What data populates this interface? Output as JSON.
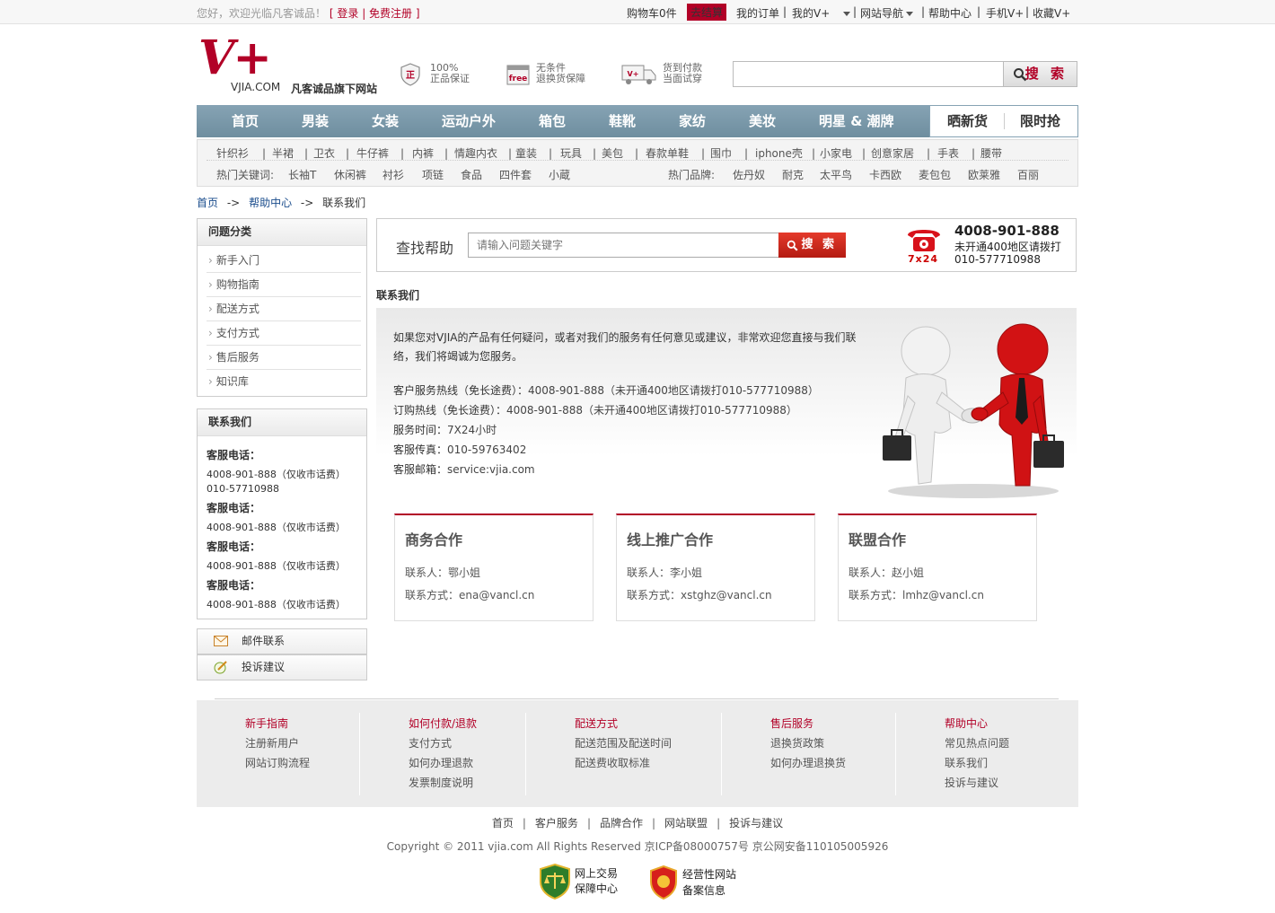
{
  "topbar": {
    "greeting": "您好，欢迎光临凡客诚品！",
    "login": "登录",
    "register": "免费注册",
    "cart": "购物车0件",
    "checkout": "去结算",
    "orders": "我的订单",
    "my_vplus": "我的V+",
    "site_nav": "网站导航",
    "help": "帮助中心",
    "mobile": "手机V+",
    "favorite": "收藏V+"
  },
  "header": {
    "logo_mark": "V+",
    "logo_domain": "VJIA.COM",
    "logo_tagline": "凡客诚品旗下网站",
    "promo1_line1": "100%",
    "promo1_line2": "正品保证",
    "promo1_icon": "正",
    "promo2_line1": "无条件",
    "promo2_line2": "退换货保障",
    "promo2_icon": "free",
    "promo3_line1": "货到付款",
    "promo3_line2": "当面试穿",
    "search_label": "搜 索"
  },
  "nav": {
    "items": [
      "首页",
      "男装",
      "女装",
      "运动户外",
      "箱包",
      "鞋靴",
      "家纺",
      "美妆",
      "明星 & 潮牌"
    ],
    "special": [
      "晒新货",
      "限时抢"
    ]
  },
  "subnav": {
    "categories": [
      "针织衫",
      "半裙",
      "卫衣",
      "牛仔裤",
      "内裤",
      "情趣内衣",
      "童装",
      "玩具",
      "美包",
      "春款单鞋",
      "围巾",
      "iphone壳",
      "小家电",
      "创意家居",
      "手表",
      "腰带"
    ],
    "hot_keywords_label": "热门关键词:",
    "hot_keywords": [
      "长袖T",
      "休闲裤",
      "衬衫",
      "项链",
      "食品",
      "四件套",
      "小蔵"
    ],
    "hot_brands_label": "热门品牌:",
    "hot_brands": [
      "佐丹奴",
      "耐克",
      "太平鸟",
      "卡西欧",
      "麦包包",
      "欧莱雅",
      "百丽"
    ]
  },
  "breadcrumb": {
    "home": "首页",
    "arrow": "->",
    "help": "帮助中心",
    "current": "联系我们"
  },
  "sidebar": {
    "category_title": "问题分类",
    "categories": [
      "新手入门",
      "购物指南",
      "配送方式",
      "支付方式",
      "售后服务",
      "知识库"
    ],
    "contact_title": "联系我们",
    "service": [
      {
        "label": "客服电话：",
        "lines": [
          "4008-901-888（仅收市话费）",
          "010-57710988"
        ]
      },
      {
        "label": "客服电话：",
        "lines": [
          "4008-901-888（仅收市话费）"
        ]
      },
      {
        "label": "客服电话：",
        "lines": [
          "4008-901-888（仅收市话费）"
        ]
      },
      {
        "label": "客服电话：",
        "lines": [
          "4008-901-888（仅收市话费）"
        ]
      }
    ],
    "email_contact": "邮件联系",
    "complaint": "投诉建议"
  },
  "help_search": {
    "title": "查找帮助",
    "placeholder": "请输入问题关键字",
    "button": "搜 索",
    "hotline": "4008-901-888",
    "hotline_note": "未开通400地区请拨打",
    "hotline_alt": "010-577710988",
    "hours_badge": "7x24"
  },
  "contact": {
    "section_title": "联系我们",
    "intro1": "如果您对VJIA的产品有任何疑问，或者对我们的服务有任何意见或建议，非常欢迎您直接与我们联",
    "intro2": "络，我们将竭诚为您服务。",
    "rows": [
      {
        "label": "客户服务热线（免长途费）：",
        "value": "4008-901-888（未开通400地区请拨打010-577710988）"
      },
      {
        "label": "订购热线（免长途费）：",
        "value": "4008-901-888（未开通400地区请拨打010-577710988）"
      },
      {
        "label": "服务时间：",
        "value": "7X24小时"
      },
      {
        "label": "客服传真：",
        "value": "010-59763402"
      },
      {
        "label": "客服邮箱：",
        "value": "service:vjia.com"
      }
    ],
    "cards": [
      {
        "title": "商务合作",
        "person_label": "联系人：",
        "person": "鄂小姐",
        "method_label": "联系方式：",
        "method": "ena@vancl.cn"
      },
      {
        "title": "线上推广合作",
        "person_label": "联系人：",
        "person": "李小姐",
        "method_label": "联系方式：",
        "method": "xstghz@vancl.cn"
      },
      {
        "title": "联盟合作",
        "person_label": "联系人：",
        "person": "赵小姐",
        "method_label": "联系方式：",
        "method": "lmhz@vancl.cn"
      }
    ]
  },
  "footer": {
    "columns": [
      {
        "title": "新手指南",
        "items": [
          "注册新用户",
          "网站订购流程"
        ]
      },
      {
        "title": "如何付款/退款",
        "items": [
          "支付方式",
          "如何办理退款",
          "发票制度说明"
        ]
      },
      {
        "title": "配送方式",
        "items": [
          "配送范围及配送时间",
          "配送费收取标准"
        ]
      },
      {
        "title": "售后服务",
        "items": [
          "退换货政策",
          "如何办理退换货"
        ]
      },
      {
        "title": "帮助中心",
        "items": [
          "常见热点问题",
          "联系我们",
          "投诉与建议"
        ]
      }
    ],
    "bottom_links": [
      "首页",
      "客户服务",
      "品牌合作",
      "网站联盟",
      "投诉与建议"
    ],
    "link_separator": "|",
    "copyright": "Copyright © 2011 vjia.com All Rights Reserved 京ICP备08000757号 京公网安备110105005926",
    "badge1_line1": "网上交易",
    "badge1_line2": "保障中心",
    "badge2_line1": "经营性网站",
    "badge2_line2": "备案信息"
  },
  "colors": {
    "brand": "#b20027",
    "nav": "#7896a8"
  }
}
